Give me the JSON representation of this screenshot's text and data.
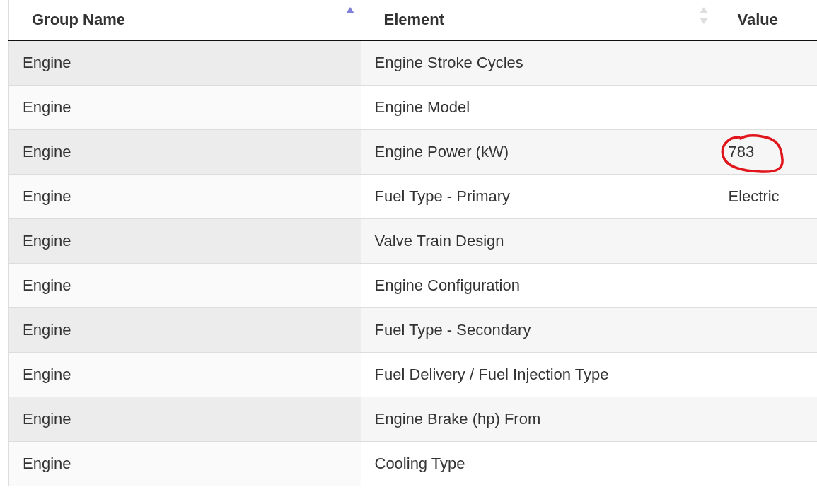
{
  "table": {
    "columns": [
      {
        "label": "Group Name",
        "sorted": true
      },
      {
        "label": "Element",
        "sorted": false
      },
      {
        "label": "Value"
      }
    ],
    "rows": [
      {
        "cells": [
          "Engine",
          "Engine Stroke Cycles",
          ""
        ]
      },
      {
        "cells": [
          "Engine",
          "Engine Model",
          ""
        ]
      },
      {
        "cells": [
          "Engine",
          "Engine Power (kW)",
          "783"
        ],
        "circled": true
      },
      {
        "cells": [
          "Engine",
          "Fuel Type - Primary",
          "Electric"
        ]
      },
      {
        "cells": [
          "Engine",
          "Valve Train Design",
          ""
        ]
      },
      {
        "cells": [
          "Engine",
          "Engine Configuration",
          ""
        ]
      },
      {
        "cells": [
          "Engine",
          "Fuel Type - Secondary",
          ""
        ]
      },
      {
        "cells": [
          "Engine",
          "Fuel Delivery / Fuel Injection Type",
          ""
        ]
      },
      {
        "cells": [
          "Engine",
          "Engine Brake (hp) From",
          ""
        ]
      },
      {
        "cells": [
          "Engine",
          "Cooling Type",
          ""
        ]
      }
    ]
  }
}
